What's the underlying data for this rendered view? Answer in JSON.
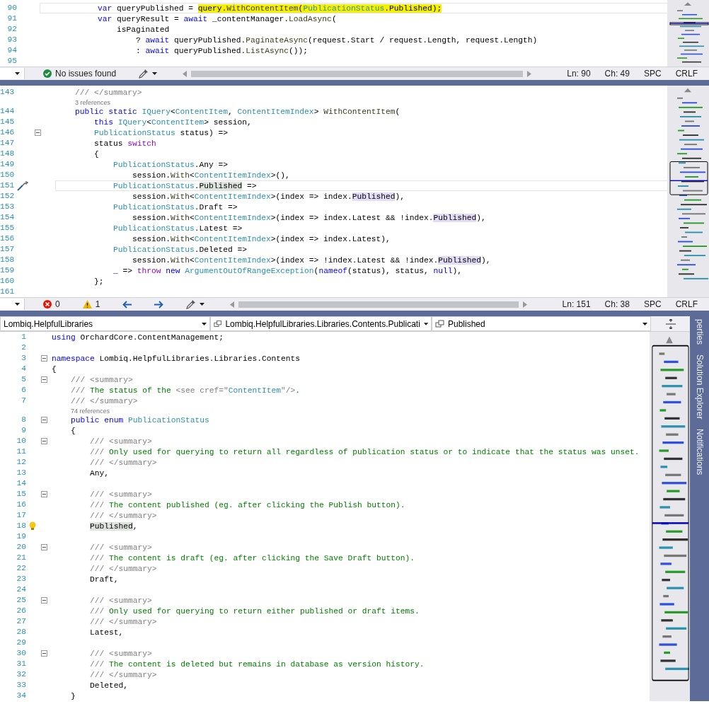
{
  "editors": [
    {
      "lines": [
        {
          "number": "90",
          "current": true,
          "fold": false,
          "segments": [
            {
              "kind": "kw",
              "text": "            var"
            },
            {
              "kind": "p",
              "text": " queryPublished = "
            },
            {
              "kind": "p-marker",
              "text": "query."
            },
            {
              "kind": "meth-marker",
              "text": "WithContentItem"
            },
            {
              "kind": "p-marker",
              "text": "("
            },
            {
              "kind": "type-marker",
              "text": "PublicationStatus"
            },
            {
              "kind": "p-marker",
              "text": ".Published);"
            }
          ]
        },
        {
          "number": "91",
          "current": false,
          "fold": false,
          "segments": [
            {
              "kind": "kw",
              "text": "            var"
            },
            {
              "kind": "p",
              "text": " queryResult = "
            },
            {
              "kind": "kw",
              "text": "await"
            },
            {
              "kind": "p",
              "text": " _contentManager."
            },
            {
              "kind": "meth",
              "text": "LoadAsync"
            },
            {
              "kind": "p",
              "text": "("
            }
          ]
        },
        {
          "number": "92",
          "current": false,
          "fold": false,
          "segments": [
            {
              "kind": "p",
              "text": "                isPaginated"
            }
          ]
        },
        {
          "number": "93",
          "current": false,
          "fold": false,
          "segments": [
            {
              "kind": "p",
              "text": "                    ? "
            },
            {
              "kind": "kw",
              "text": "await"
            },
            {
              "kind": "p",
              "text": " queryPublished."
            },
            {
              "kind": "meth",
              "text": "PaginateAsync"
            },
            {
              "kind": "p",
              "text": "(request.Start / request.Length, request.Length)"
            }
          ]
        },
        {
          "number": "94",
          "current": false,
          "fold": false,
          "segments": [
            {
              "kind": "p",
              "text": "                    : "
            },
            {
              "kind": "kw",
              "text": "await"
            },
            {
              "kind": "p",
              "text": " queryPublished."
            },
            {
              "kind": "meth",
              "text": "ListAsync"
            },
            {
              "kind": "p",
              "text": "());"
            }
          ]
        },
        {
          "number": "95",
          "current": false,
          "fold": false
        }
      ],
      "status_bar": [
        {
          "kind": "zoom"
        },
        {
          "kind": "ok",
          "text": "No issues found"
        },
        {
          "kind": "brush"
        },
        {
          "kind": "scroll"
        },
        {
          "kind": "text",
          "text": "Ln: 90"
        },
        {
          "kind": "text",
          "text": "Ch: 49"
        },
        {
          "kind": "text",
          "text": "SPC"
        },
        {
          "kind": "text",
          "text": "CRLF"
        }
      ]
    },
    {
      "lines": [
        {
          "number": "143",
          "current": false,
          "fold": false,
          "segments": [
            {
              "kind": "doc",
              "text": "    /// </summary>"
            }
          ]
        },
        {
          "kind": "codelens",
          "segments": [
            {
              "kind": "lens",
              "text": "    3 references"
            }
          ]
        },
        {
          "number": "144",
          "current": false,
          "fold": false,
          "segments": [
            {
              "kind": "kw",
              "text": "    public static "
            },
            {
              "kind": "type",
              "text": "IQuery"
            },
            {
              "kind": "p",
              "text": "<"
            },
            {
              "kind": "type",
              "text": "ContentItem"
            },
            {
              "kind": "p",
              "text": ", "
            },
            {
              "kind": "type",
              "text": "ContentItemIndex"
            },
            {
              "kind": "p",
              "text": "> "
            },
            {
              "kind": "meth",
              "text": "WithContentItem"
            },
            {
              "kind": "p",
              "text": "("
            }
          ]
        },
        {
          "number": "145",
          "current": false,
          "fold": false,
          "segments": [
            {
              "kind": "kw",
              "text": "        this "
            },
            {
              "kind": "type",
              "text": "IQuery"
            },
            {
              "kind": "p",
              "text": "<"
            },
            {
              "kind": "type",
              "text": "ContentItem"
            },
            {
              "kind": "p",
              "text": "> session,"
            }
          ]
        },
        {
          "number": "146",
          "current": false,
          "fold": true,
          "segments": [
            {
              "kind": "type",
              "text": "        PublicationStatus"
            },
            {
              "kind": "p",
              "text": " status) =>"
            }
          ]
        },
        {
          "number": "147",
          "current": false,
          "fold": false,
          "segments": [
            {
              "kind": "p",
              "text": "        status "
            },
            {
              "kind": "ctrl",
              "text": "switch"
            }
          ]
        },
        {
          "number": "148",
          "current": false,
          "fold": false,
          "segments": [
            {
              "kind": "p",
              "text": "        {"
            }
          ]
        },
        {
          "number": "149",
          "current": false,
          "fold": false,
          "segments": [
            {
              "kind": "type",
              "text": "            PublicationStatus"
            },
            {
              "kind": "p",
              "text": ".Any =>"
            }
          ]
        },
        {
          "number": "150",
          "current": false,
          "fold": false,
          "segments": [
            {
              "kind": "p",
              "text": "                session."
            },
            {
              "kind": "meth",
              "text": "With"
            },
            {
              "kind": "p",
              "text": "<"
            },
            {
              "kind": "type",
              "text": "ContentItemIndex"
            },
            {
              "kind": "p",
              "text": ">(),"
            }
          ]
        },
        {
          "number": "151",
          "current": true,
          "fold": false,
          "glyph": {
            "kind": "brush"
          },
          "segments": [
            {
              "kind": "type",
              "text": "            PublicationStatus"
            },
            {
              "kind": "p",
              "text": "."
            },
            {
              "kind": "p-def",
              "text": "Published"
            },
            {
              "kind": "p",
              "text": " =>"
            }
          ]
        },
        {
          "number": "152",
          "current": false,
          "fold": false,
          "segments": [
            {
              "kind": "p",
              "text": "                session."
            },
            {
              "kind": "meth",
              "text": "With"
            },
            {
              "kind": "p",
              "text": "<"
            },
            {
              "kind": "type",
              "text": "ContentItemIndex"
            },
            {
              "kind": "p",
              "text": ">(index => index."
            },
            {
              "kind": "p-ref",
              "text": "Published"
            },
            {
              "kind": "p",
              "text": "),"
            }
          ]
        },
        {
          "number": "153",
          "current": false,
          "fold": false,
          "segments": [
            {
              "kind": "type",
              "text": "            PublicationStatus"
            },
            {
              "kind": "p",
              "text": ".Draft =>"
            }
          ]
        },
        {
          "number": "154",
          "current": false,
          "fold": false,
          "segments": [
            {
              "kind": "p",
              "text": "                session."
            },
            {
              "kind": "meth",
              "text": "With"
            },
            {
              "kind": "p",
              "text": "<"
            },
            {
              "kind": "type",
              "text": "ContentItemIndex"
            },
            {
              "kind": "p",
              "text": ">(index => index.Latest && !index."
            },
            {
              "kind": "p-ref",
              "text": "Published"
            },
            {
              "kind": "p",
              "text": "),"
            }
          ]
        },
        {
          "number": "155",
          "current": false,
          "fold": false,
          "segments": [
            {
              "kind": "type",
              "text": "            PublicationStatus"
            },
            {
              "kind": "p",
              "text": ".Latest =>"
            }
          ]
        },
        {
          "number": "156",
          "current": false,
          "fold": false,
          "segments": [
            {
              "kind": "p",
              "text": "                session."
            },
            {
              "kind": "meth",
              "text": "With"
            },
            {
              "kind": "p",
              "text": "<"
            },
            {
              "kind": "type",
              "text": "ContentItemIndex"
            },
            {
              "kind": "p",
              "text": ">(index => index.Latest),"
            }
          ]
        },
        {
          "number": "157",
          "current": false,
          "fold": false,
          "segments": [
            {
              "kind": "type",
              "text": "            PublicationStatus"
            },
            {
              "kind": "p",
              "text": ".Deleted =>"
            }
          ]
        },
        {
          "number": "158",
          "current": false,
          "fold": false,
          "segments": [
            {
              "kind": "p",
              "text": "                session."
            },
            {
              "kind": "meth",
              "text": "With"
            },
            {
              "kind": "p",
              "text": "<"
            },
            {
              "kind": "type",
              "text": "ContentItemIndex"
            },
            {
              "kind": "p",
              "text": ">(index => !index.Latest && !index."
            },
            {
              "kind": "p-ref",
              "text": "Published"
            },
            {
              "kind": "p",
              "text": "),"
            }
          ]
        },
        {
          "number": "159",
          "current": false,
          "fold": false,
          "segments": [
            {
              "kind": "kw",
              "text": "            _"
            },
            {
              "kind": "p",
              "text": " => "
            },
            {
              "kind": "ctrl",
              "text": "throw"
            },
            {
              "kind": "kw",
              "text": " new "
            },
            {
              "kind": "type",
              "text": "ArgumentOutOfRangeException"
            },
            {
              "kind": "p",
              "text": "("
            },
            {
              "kind": "kw",
              "text": "nameof"
            },
            {
              "kind": "p",
              "text": "(status), status, "
            },
            {
              "kind": "kw",
              "text": "null"
            },
            {
              "kind": "p",
              "text": "),"
            }
          ]
        },
        {
          "number": "160",
          "current": false,
          "fold": false,
          "segments": [
            {
              "kind": "p",
              "text": "        };"
            }
          ]
        },
        {
          "number": "161",
          "current": false,
          "fold": false
        }
      ],
      "status_bar": [
        {
          "kind": "zoom"
        },
        {
          "kind": "errors",
          "text": "0"
        },
        {
          "kind": "warnings",
          "text": "1"
        },
        {
          "kind": "nav"
        },
        {
          "kind": "brush"
        },
        {
          "kind": "scroll"
        },
        {
          "kind": "text",
          "text": "Ln: 151"
        },
        {
          "kind": "text",
          "text": "Ch: 38"
        },
        {
          "kind": "text",
          "text": "SPC"
        },
        {
          "kind": "text",
          "text": "CRLF"
        }
      ]
    },
    {
      "navigation_bar": [
        {
          "kind": "project",
          "text": "Lombiq.HelpfulLibraries"
        },
        {
          "kind": "type",
          "text": "Lombiq.HelpfulLibraries.Libraries.Contents.Publicati"
        },
        {
          "kind": "member",
          "text": "Published"
        }
      ],
      "lines": [
        {
          "number": "1",
          "current": false,
          "fold": false,
          "segments": [
            {
              "kind": "kw",
              "text": "using"
            },
            {
              "kind": "p",
              "text": " OrchardCore.ContentManagement;"
            }
          ]
        },
        {
          "number": "2",
          "current": false,
          "fold": false
        },
        {
          "number": "3",
          "current": false,
          "fold": true,
          "segments": [
            {
              "kind": "kw",
              "text": "namespace"
            },
            {
              "kind": "p",
              "text": " Lombiq.HelpfulLibraries.Libraries.Contents"
            }
          ]
        },
        {
          "number": "4",
          "current": false,
          "fold": false,
          "segments": [
            {
              "kind": "p",
              "text": "{"
            }
          ]
        },
        {
          "number": "5",
          "current": false,
          "fold": true,
          "segments": [
            {
              "kind": "doc",
              "text": "    /// <summary>"
            }
          ]
        },
        {
          "number": "6",
          "current": false,
          "fold": false,
          "segments": [
            {
              "kind": "doc",
              "text": "    ///"
            },
            {
              "kind": "cmt",
              "text": " The status of the "
            },
            {
              "kind": "doc",
              "text": "<see cref=\""
            },
            {
              "kind": "type",
              "text": "ContentItem"
            },
            {
              "kind": "doc",
              "text": "\"/>"
            },
            {
              "kind": "cmt",
              "text": "."
            }
          ]
        },
        {
          "number": "7",
          "current": false,
          "fold": false,
          "segments": [
            {
              "kind": "doc",
              "text": "    /// </summary>"
            }
          ]
        },
        {
          "kind": "codelens",
          "segments": [
            {
              "kind": "lens",
              "text": "    74 references"
            }
          ]
        },
        {
          "number": "8",
          "current": false,
          "fold": true,
          "segments": [
            {
              "kind": "kw",
              "text": "    public enum "
            },
            {
              "kind": "type",
              "text": "PublicationStatus"
            }
          ]
        },
        {
          "number": "9",
          "current": false,
          "fold": false,
          "segments": [
            {
              "kind": "p",
              "text": "    {"
            }
          ]
        },
        {
          "number": "10",
          "current": false,
          "fold": true,
          "segments": [
            {
              "kind": "doc",
              "text": "        /// <summary>"
            }
          ]
        },
        {
          "number": "11",
          "current": false,
          "fold": false,
          "segments": [
            {
              "kind": "doc",
              "text": "        ///"
            },
            {
              "kind": "cmt",
              "text": " Only used for querying to return all regardless of publication status or to indicate that the status was unset."
            }
          ]
        },
        {
          "number": "12",
          "current": false,
          "fold": false,
          "segments": [
            {
              "kind": "doc",
              "text": "        /// </summary>"
            }
          ]
        },
        {
          "number": "13",
          "current": false,
          "fold": false,
          "segments": [
            {
              "kind": "p",
              "text": "        Any,"
            }
          ]
        },
        {
          "number": "14",
          "current": false,
          "fold": false
        },
        {
          "number": "15",
          "current": false,
          "fold": true,
          "segments": [
            {
              "kind": "doc",
              "text": "        /// <summary>"
            }
          ]
        },
        {
          "number": "16",
          "current": false,
          "fold": false,
          "segments": [
            {
              "kind": "doc",
              "text": "        ///"
            },
            {
              "kind": "cmt",
              "text": " The content published (eg. after clicking the Publish button)."
            }
          ]
        },
        {
          "number": "17",
          "current": false,
          "fold": false,
          "segments": [
            {
              "kind": "doc",
              "text": "        /// </summary>"
            }
          ]
        },
        {
          "number": "18",
          "current": false,
          "fold": false,
          "glyph": {
            "kind": "lightbulb"
          },
          "segments": [
            {
              "kind": "p-def",
              "text": "        Published"
            },
            {
              "kind": "p",
              "text": ","
            }
          ]
        },
        {
          "number": "19",
          "current": false,
          "fold": false
        },
        {
          "number": "20",
          "current": false,
          "fold": true,
          "segments": [
            {
              "kind": "doc",
              "text": "        /// <summary>"
            }
          ]
        },
        {
          "number": "21",
          "current": false,
          "fold": false,
          "segments": [
            {
              "kind": "doc",
              "text": "        ///"
            },
            {
              "kind": "cmt",
              "text": " The content is draft (eg. after clicking the Save Draft button)."
            }
          ]
        },
        {
          "number": "22",
          "current": false,
          "fold": false,
          "segments": [
            {
              "kind": "doc",
              "text": "        /// </summary>"
            }
          ]
        },
        {
          "number": "23",
          "current": false,
          "fold": false,
          "segments": [
            {
              "kind": "p",
              "text": "        Draft,"
            }
          ]
        },
        {
          "number": "24",
          "current": false,
          "fold": false
        },
        {
          "number": "25",
          "current": false,
          "fold": true,
          "segments": [
            {
              "kind": "doc",
              "text": "        /// <summary>"
            }
          ]
        },
        {
          "number": "26",
          "current": false,
          "fold": false,
          "segments": [
            {
              "kind": "doc",
              "text": "        ///"
            },
            {
              "kind": "cmt",
              "text": " Only used for querying to return either published or draft items."
            }
          ]
        },
        {
          "number": "27",
          "current": false,
          "fold": false,
          "segments": [
            {
              "kind": "doc",
              "text": "        /// </summary>"
            }
          ]
        },
        {
          "number": "28",
          "current": false,
          "fold": false,
          "segments": [
            {
              "kind": "p",
              "text": "        Latest,"
            }
          ]
        },
        {
          "number": "29",
          "current": false,
          "fold": false
        },
        {
          "number": "30",
          "current": false,
          "fold": true,
          "segments": [
            {
              "kind": "doc",
              "text": "        /// <summary>"
            }
          ]
        },
        {
          "number": "31",
          "current": false,
          "fold": false,
          "segments": [
            {
              "kind": "doc",
              "text": "        ///"
            },
            {
              "kind": "cmt",
              "text": " The content is deleted but remains in database as version history."
            }
          ]
        },
        {
          "number": "32",
          "current": false,
          "fold": false,
          "segments": [
            {
              "kind": "doc",
              "text": "        /// </summary>"
            }
          ]
        },
        {
          "number": "33",
          "current": false,
          "fold": false,
          "segments": [
            {
              "kind": "p",
              "text": "        Deleted,"
            }
          ]
        },
        {
          "number": "34",
          "current": false,
          "fold": false,
          "segments": [
            {
              "kind": "p",
              "text": "    }"
            }
          ]
        }
      ]
    }
  ],
  "tool_window_tabs": [
    "perties",
    "Solution Explorer",
    "Notifications"
  ]
}
